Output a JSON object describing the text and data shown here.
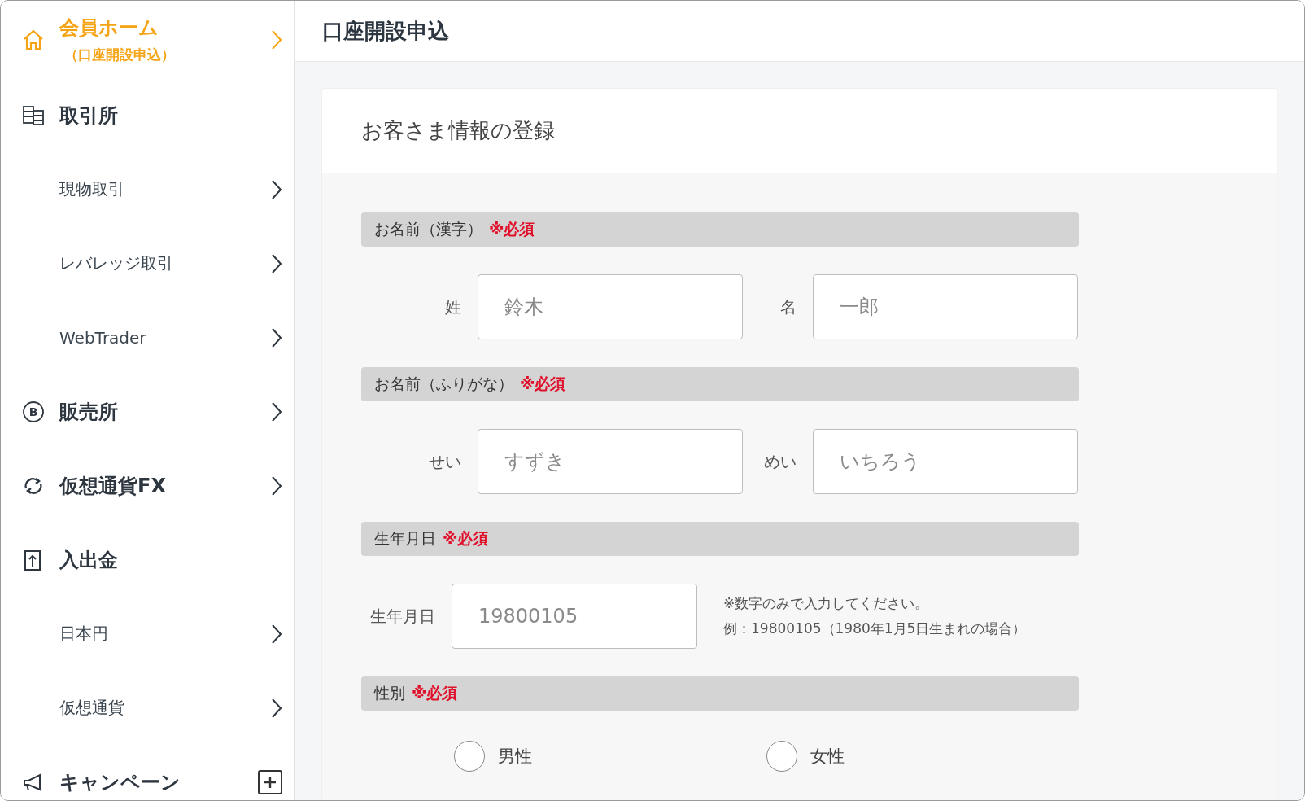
{
  "sidebar": {
    "items": [
      {
        "kind": "current",
        "label": "会員ホーム",
        "sublabel": "（口座開設申込）"
      },
      {
        "kind": "heading",
        "label": "取引所"
      },
      {
        "kind": "subitem",
        "label": "現物取引"
      },
      {
        "kind": "subitem",
        "label": "レバレッジ取引"
      },
      {
        "kind": "subitem",
        "label": "WebTrader"
      },
      {
        "kind": "link",
        "label": "販売所",
        "glyph": "B"
      },
      {
        "kind": "link",
        "label": "仮想通貨FX"
      },
      {
        "kind": "heading",
        "label": "入出金"
      },
      {
        "kind": "subitem",
        "label": "日本円"
      },
      {
        "kind": "subitem",
        "label": "仮想通貨"
      },
      {
        "kind": "toggle",
        "label": "キャンペーン",
        "expanded": false
      }
    ]
  },
  "page": {
    "title": "口座開設申込"
  },
  "card": {
    "title": "お客さま情報の登録",
    "sections": [
      {
        "kind": "pair",
        "title": "お名前（漢字）",
        "required": "※必須",
        "fields": [
          {
            "label": "姓",
            "placeholder": "鈴木"
          },
          {
            "label": "名",
            "placeholder": "一郎"
          }
        ]
      },
      {
        "kind": "pair",
        "title": "お名前（ふりがな）",
        "required": "※必須",
        "fields": [
          {
            "label": "せい",
            "placeholder": "すずき"
          },
          {
            "label": "めい",
            "placeholder": "いちろう"
          }
        ]
      },
      {
        "kind": "date",
        "title": "生年月日",
        "required": "※必須",
        "fields": [
          {
            "label": "生年月日",
            "placeholder": "19800105"
          }
        ],
        "notes": [
          "※数字のみで入力してください。",
          "例：19800105（1980年1月5日生まれの場合）"
        ]
      },
      {
        "kind": "radio",
        "title": "性別",
        "required": "※必須",
        "options": [
          {
            "label": "男性",
            "selected": false
          },
          {
            "label": "女性",
            "selected": false
          }
        ]
      }
    ]
  }
}
